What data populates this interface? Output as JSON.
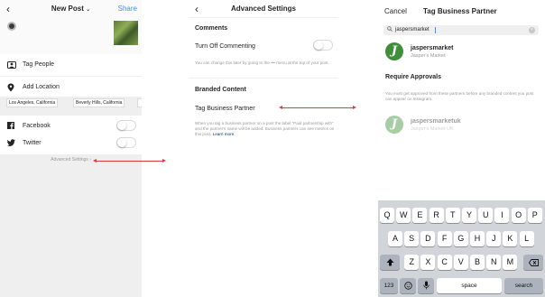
{
  "screen1": {
    "title": "New Post",
    "chevron": "⌄",
    "share": "Share",
    "tag_people": "Tag People",
    "add_location": "Add Location",
    "location_chips": [
      "Los Angeles, California",
      "Beverly Hills, California"
    ],
    "facebook": "Facebook",
    "twitter": "Twitter",
    "advanced_settings": "Advanced Settings",
    "advanced_chevron": "›"
  },
  "screen2": {
    "title": "Advanced Settings",
    "comments_header": "Comments",
    "turn_off_commenting": "Turn Off Commenting",
    "commenting_note": "You can change this later by going to the ••• menu at the top of your post.",
    "branded_header": "Branded Content",
    "tag_business_partner": "Tag Business Partner",
    "branded_note": "When you tag a business partner on a post the label \"Paid partnership with\" and the partner's name will be added. Business partners can see metrics on this post.",
    "learn_more": "Learn more."
  },
  "screen3": {
    "cancel": "Cancel",
    "title": "Tag Business Partner",
    "search_value": "jaspersmarket",
    "partner1": {
      "handle": "jaspersmarket",
      "name": "Jasper's Market"
    },
    "require_approvals": "Require Approvals",
    "approval_note": "You must get approved from these partners before any branded content you post can appear on Instagram.",
    "partner2": {
      "handle": "jaspersmarketuk",
      "name": "Jasper's Market UK"
    }
  },
  "keyboard": {
    "row1": [
      "Q",
      "W",
      "E",
      "R",
      "T",
      "Y",
      "U",
      "I",
      "O",
      "P"
    ],
    "row2": [
      "A",
      "S",
      "D",
      "F",
      "G",
      "H",
      "J",
      "K",
      "L"
    ],
    "row3": [
      "Z",
      "X",
      "C",
      "V",
      "B",
      "N",
      "M"
    ],
    "numbers": "123",
    "space": "space",
    "search": "search"
  },
  "icons": {
    "back": "back-chevron-icon",
    "tag": "tag-people-icon",
    "location": "location-pin-icon",
    "facebook": "facebook-icon",
    "twitter": "twitter-icon",
    "search": "search-icon",
    "clear": "clear-icon",
    "shift": "shift-icon",
    "delete": "delete-icon",
    "emoji": "emoji-icon",
    "mic": "mic-icon"
  },
  "colors": {
    "link_blue": "#3897f0",
    "arrow_red": "#e03a3a",
    "partner_green": "#3f8f3a"
  }
}
